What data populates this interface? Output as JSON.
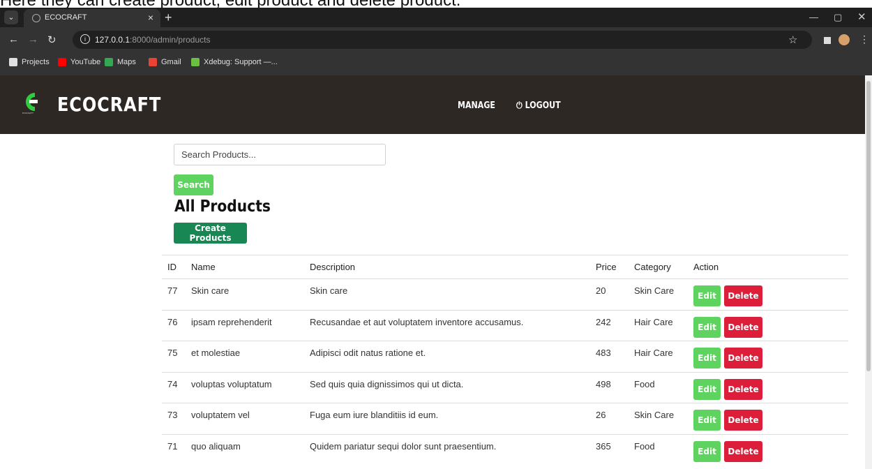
{
  "caption": "Here they can create product, edit product and delete product.",
  "browser": {
    "tab_title": "ECOCRAFT",
    "url_host": "127.0.0.1",
    "url_rest": ":8000/admin/products",
    "bookmarks": [
      {
        "label": "Projects",
        "icon": "globe-icon",
        "color": "#e0e0e0"
      },
      {
        "label": "YouTube",
        "icon": "youtube-icon",
        "color": "#ff0000"
      },
      {
        "label": "Maps",
        "icon": "maps-icon",
        "color": "#34a853"
      },
      {
        "label": "Gmail",
        "icon": "gmail-icon",
        "color": "#ea4335"
      },
      {
        "label": "Xdebug: Support —...",
        "icon": "xdebug-icon",
        "color": "#6cbf43"
      }
    ]
  },
  "site": {
    "brand": "ECOCRAFT",
    "nav_manage": "MANAGE",
    "nav_logout": "LOGOUT",
    "accent": "#2ecc40"
  },
  "search": {
    "placeholder": "Search Products...",
    "button": "Search"
  },
  "page": {
    "title": "All Products",
    "create_button": "Create Products"
  },
  "table": {
    "columns": [
      "ID",
      "Name",
      "Description",
      "Price",
      "Category",
      "Action"
    ],
    "rows": [
      {
        "id": "77",
        "name": "Skin care",
        "description": "Skin care",
        "price": "20",
        "category": "Skin Care"
      },
      {
        "id": "76",
        "name": "ipsam reprehenderit",
        "description": "Recusandae et aut voluptatem inventore accusamus.",
        "price": "242",
        "category": "Hair Care"
      },
      {
        "id": "75",
        "name": "et molestiae",
        "description": "Adipisci odit natus ratione et.",
        "price": "483",
        "category": "Hair Care"
      },
      {
        "id": "74",
        "name": "voluptas voluptatum",
        "description": "Sed quis quia dignissimos qui ut dicta.",
        "price": "498",
        "category": "Food"
      },
      {
        "id": "73",
        "name": "voluptatem vel",
        "description": "Fuga eum iure blanditiis id eum.",
        "price": "26",
        "category": "Skin Care"
      },
      {
        "id": "71",
        "name": "quo aliquam",
        "description": "Quidem pariatur sequi dolor sunt praesentium.",
        "price": "365",
        "category": "Food"
      }
    ],
    "edit_label": "Edit",
    "delete_label": "Delete",
    "edit_color": "#5fd35f",
    "delete_color": "#dc1e3a"
  }
}
